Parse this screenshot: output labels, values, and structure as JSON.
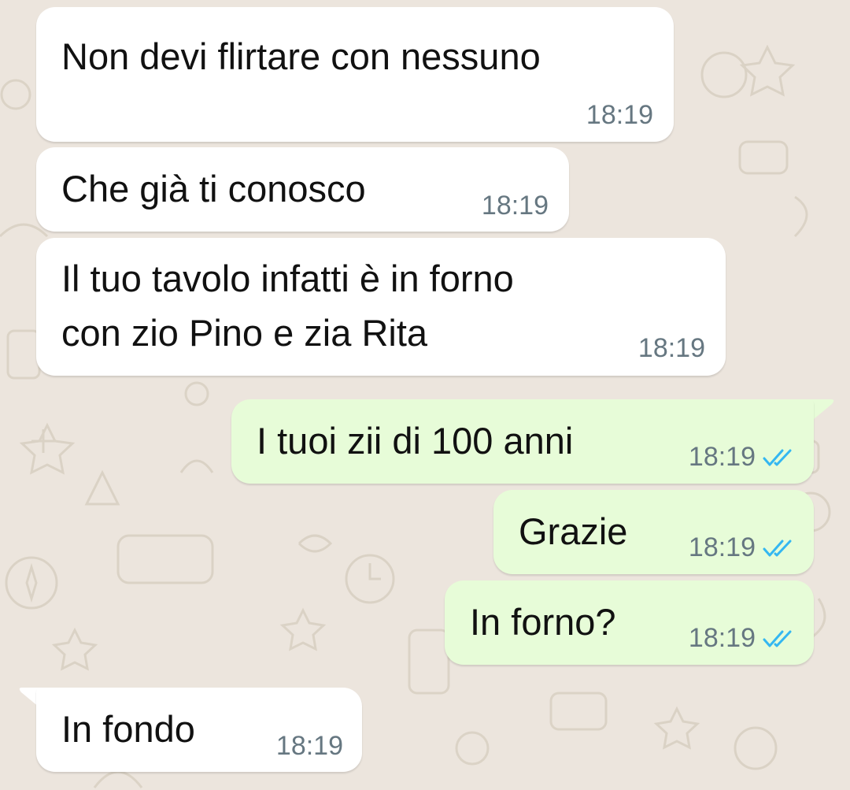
{
  "chat": {
    "messages": [
      {
        "direction": "incoming",
        "lines": [
          "Non devi flirtare con nessuno"
        ],
        "time": "18:19"
      },
      {
        "direction": "incoming",
        "lines": [
          "Che già ti conosco"
        ],
        "time": "18:19"
      },
      {
        "direction": "incoming",
        "lines": [
          "Il tuo tavolo infatti è in forno",
          "con zio Pino e zia Rita"
        ],
        "time": "18:19"
      },
      {
        "direction": "outgoing",
        "lines": [
          "I tuoi zii di 100 anni"
        ],
        "time": "18:19",
        "status": "read"
      },
      {
        "direction": "outgoing",
        "lines": [
          "Grazie"
        ],
        "time": "18:19",
        "status": "read"
      },
      {
        "direction": "outgoing",
        "lines": [
          "In forno?"
        ],
        "time": "18:19",
        "status": "read"
      },
      {
        "direction": "incoming",
        "lines": [
          "In fondo"
        ],
        "time": "18:19"
      }
    ]
  },
  "icons": {
    "read_receipt": "double-check-icon"
  },
  "colors": {
    "background": "#ECE5DD",
    "incoming_bubble": "#FFFFFF",
    "outgoing_bubble": "#E7FCD8",
    "timestamp": "#667781",
    "read_tick": "#34B7F1"
  }
}
